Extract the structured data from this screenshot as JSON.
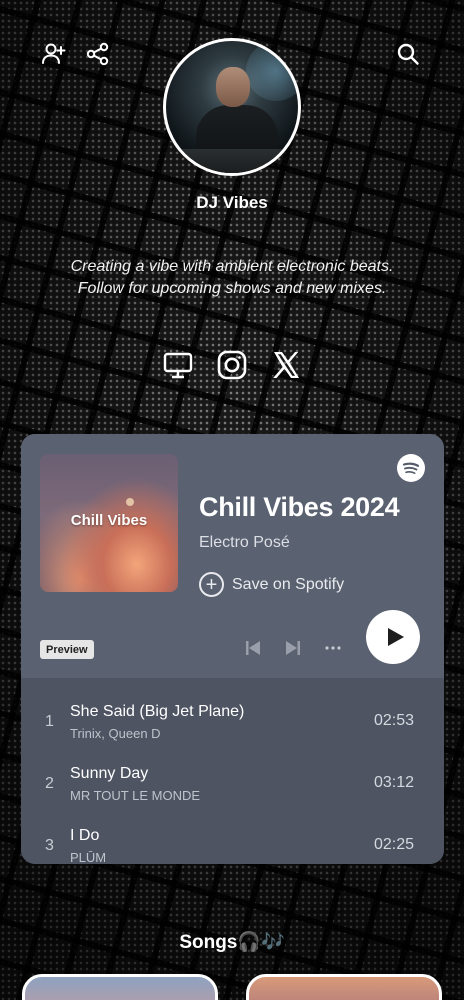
{
  "profile": {
    "name": "DJ Vibes",
    "bio_line1": "Creating a vibe with ambient electronic beats.",
    "bio_line2": "Follow for upcoming shows and new mixes."
  },
  "topbar": {
    "icons": [
      "add-user-icon",
      "share-icon",
      "search-icon"
    ]
  },
  "socials": [
    "monitor-icon",
    "instagram-icon",
    "x-icon"
  ],
  "player": {
    "cover_text": "Chill Vibes",
    "title": "Chill Vibes 2024",
    "owner": "Electro Posé",
    "save_label": "Save on Spotify",
    "preview_label": "Preview",
    "tracks": [
      {
        "num": "1",
        "title": "She Said (Big Jet Plane)",
        "artist": "Trinix, Queen D",
        "duration": "02:53"
      },
      {
        "num": "2",
        "title": "Sunny Day",
        "artist": "MR TOUT LE MONDE",
        "duration": "03:12"
      },
      {
        "num": "3",
        "title": "I Do",
        "artist": "PLŪM",
        "duration": "02:25"
      }
    ]
  },
  "songs": {
    "heading": "Songs🎧🎶"
  },
  "colors": {
    "card_bg": "#545b69",
    "tracks_bg": "#4e5462",
    "accent": "#ffffff"
  }
}
